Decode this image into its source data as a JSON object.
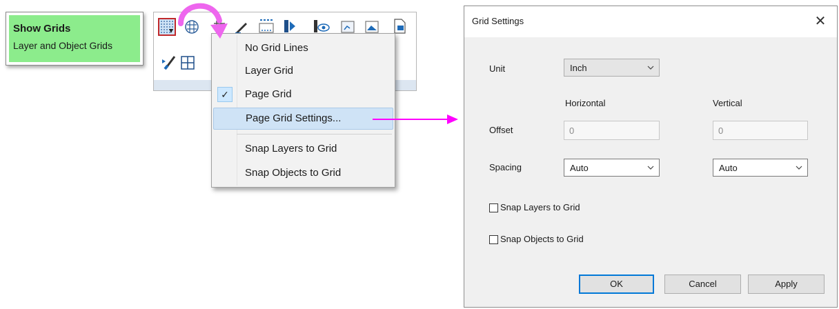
{
  "tooltip": {
    "title": "Show Grids",
    "description": "Layer and Object Grids"
  },
  "toolbar": {
    "icons": [
      "show-grids",
      "layer-grid",
      "grid-settings",
      "pen",
      "scale",
      "frame",
      "view",
      "window",
      "image",
      "export",
      "paint",
      "grid"
    ]
  },
  "menu": {
    "items": [
      {
        "label": "No Grid Lines",
        "checked": false
      },
      {
        "label": "Layer Grid",
        "checked": false
      },
      {
        "label": "Page Grid",
        "checked": true
      },
      {
        "label": "Page Grid Settings...",
        "highlighted": true
      },
      {
        "label": "Snap Layers to Grid"
      },
      {
        "label": "Snap Objects to Grid"
      }
    ],
    "check_glyph": "✓"
  },
  "dialog": {
    "title": "Grid Settings",
    "close_glyph": "✕",
    "unit_label": "Unit",
    "unit_value": "Inch",
    "horizontal_label": "Horizontal",
    "vertical_label": "Vertical",
    "offset_label": "Offset",
    "offset_horizontal": "0",
    "offset_vertical": "0",
    "spacing_label": "Spacing",
    "spacing_horizontal": "Auto",
    "spacing_vertical": "Auto",
    "snap_layers_label": "Snap Layers to Grid",
    "snap_layers_checked": false,
    "snap_objects_label": "Snap Objects to Grid",
    "snap_objects_checked": false,
    "ok_label": "OK",
    "cancel_label": "Cancel",
    "apply_label": "Apply"
  },
  "colors": {
    "annotation": "#ff00ff",
    "tooltip_bg": "#8cec8c",
    "highlight": "#cfe3f6",
    "accent": "#0078d7"
  }
}
